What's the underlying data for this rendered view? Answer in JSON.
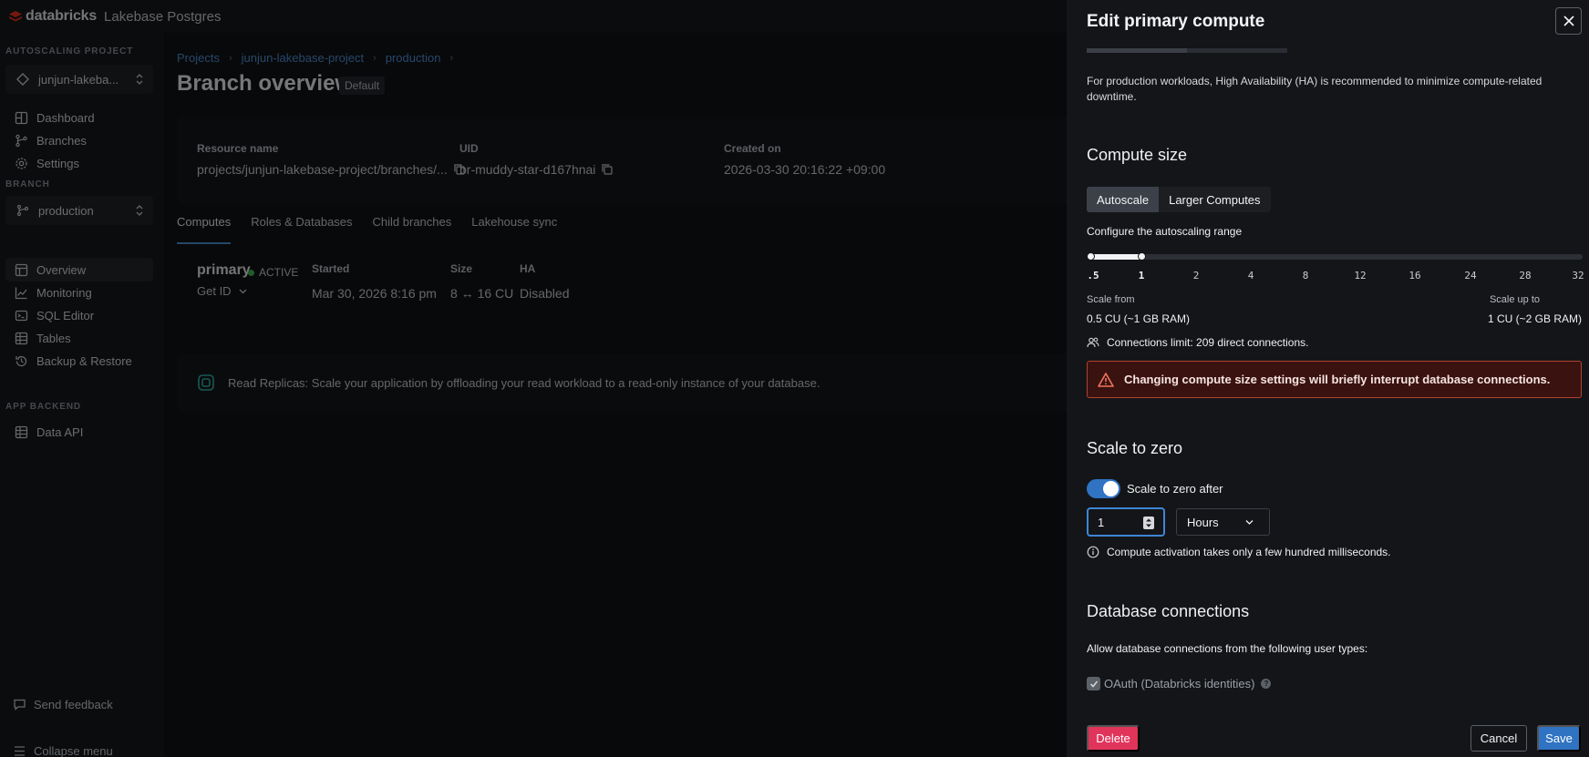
{
  "topbar": {
    "brand_name": "databricks",
    "product": "Lakebase Postgres"
  },
  "sidebar": {
    "autoscaling_project_label": "AUTOSCALING PROJECT",
    "project_selector": "junjun-lakeba...",
    "project_items": [
      {
        "label": "Dashboard",
        "icon": "dashboard-icon"
      },
      {
        "label": "Branches",
        "icon": "branch-icon"
      },
      {
        "label": "Settings",
        "icon": "gear-icon"
      }
    ],
    "branch_label": "BRANCH",
    "branch_selector": "production",
    "branch_items": [
      {
        "label": "Overview",
        "icon": "overview-icon",
        "active": true
      },
      {
        "label": "Monitoring",
        "icon": "chart-icon"
      },
      {
        "label": "SQL Editor",
        "icon": "sql-icon"
      },
      {
        "label": "Tables",
        "icon": "table-icon"
      },
      {
        "label": "Backup & Restore",
        "icon": "history-icon"
      }
    ],
    "app_backend_label": "APP BACKEND",
    "app_items": [
      {
        "label": "Data API",
        "icon": "table-icon"
      }
    ],
    "send_feedback": "Send feedback",
    "collapse_menu": "Collapse menu"
  },
  "main": {
    "breadcrumbs": [
      "Projects",
      "junjun-lakebase-project",
      "production"
    ],
    "title": "Branch overview",
    "badge": "Default",
    "info": {
      "resource_name_label": "Resource name",
      "resource_name_value": "projects/junjun-lakebase-project/branches/...",
      "uid_label": "UID",
      "uid_value": "br-muddy-star-d167hnai",
      "created_label": "Created on",
      "created_value": "2026-03-30 20:16:22 +09:00"
    },
    "tabs": [
      "Computes",
      "Roles & Databases",
      "Child branches",
      "Lakehouse sync"
    ],
    "compute": {
      "name": "primary",
      "status": "ACTIVE",
      "get_id": "Get ID",
      "started_label": "Started",
      "started_value": "Mar 30, 2026 8:16 pm",
      "size_label": "Size",
      "size_value": "8 ↔ 16 CU",
      "ha_label": "HA",
      "ha_value": "Disabled"
    },
    "replica_banner": "Read Replicas: Scale your application by offloading your read workload to a read-only instance of your database."
  },
  "drawer": {
    "title": "Edit primary compute",
    "ha_note": "For production workloads, High Availability (HA) is recommended to minimize compute-related downtime.",
    "compute_size_heading": "Compute size",
    "size_modes": [
      {
        "label": "Autoscale",
        "selected": true
      },
      {
        "label": "Larger Computes",
        "selected": false
      }
    ],
    "configure_label": "Configure the autoscaling range",
    "slider": {
      "ticks": [
        ".5",
        "1",
        "2",
        "4",
        "8",
        "12",
        "16",
        "24",
        "28",
        "32"
      ],
      "min_value": ".5",
      "max_value": "1"
    },
    "scale_from_label": "Scale from",
    "scale_from_value": "0.5 CU (~1 GB RAM)",
    "scale_up_label": "Scale up to",
    "scale_up_value": "1 CU (~2 GB RAM)",
    "connections_limit": "Connections limit: 209 direct connections.",
    "warning": "Changing compute size settings will briefly interrupt database connections.",
    "scale_to_zero_heading": "Scale to zero",
    "scale_to_zero_toggle_label": "Scale to zero after",
    "scale_to_zero_enabled": true,
    "scale_to_zero_value": "1",
    "scale_to_zero_unit": "Hours",
    "activation_note": "Compute activation takes only a few hundred milliseconds.",
    "db_connections_heading": "Database connections",
    "allow_text": "Allow database connections from the following user types:",
    "oauth_label": "OAuth (Databricks identities)",
    "oauth_help": "?",
    "delete_label": "Delete",
    "cancel_label": "Cancel",
    "save_label": "Save"
  },
  "colors": {
    "accent_blue": "#2f73c2",
    "danger": "#e0345b",
    "warning_border": "#b2432d",
    "active_green": "#3fb950",
    "brand_red": "#ff3621"
  }
}
